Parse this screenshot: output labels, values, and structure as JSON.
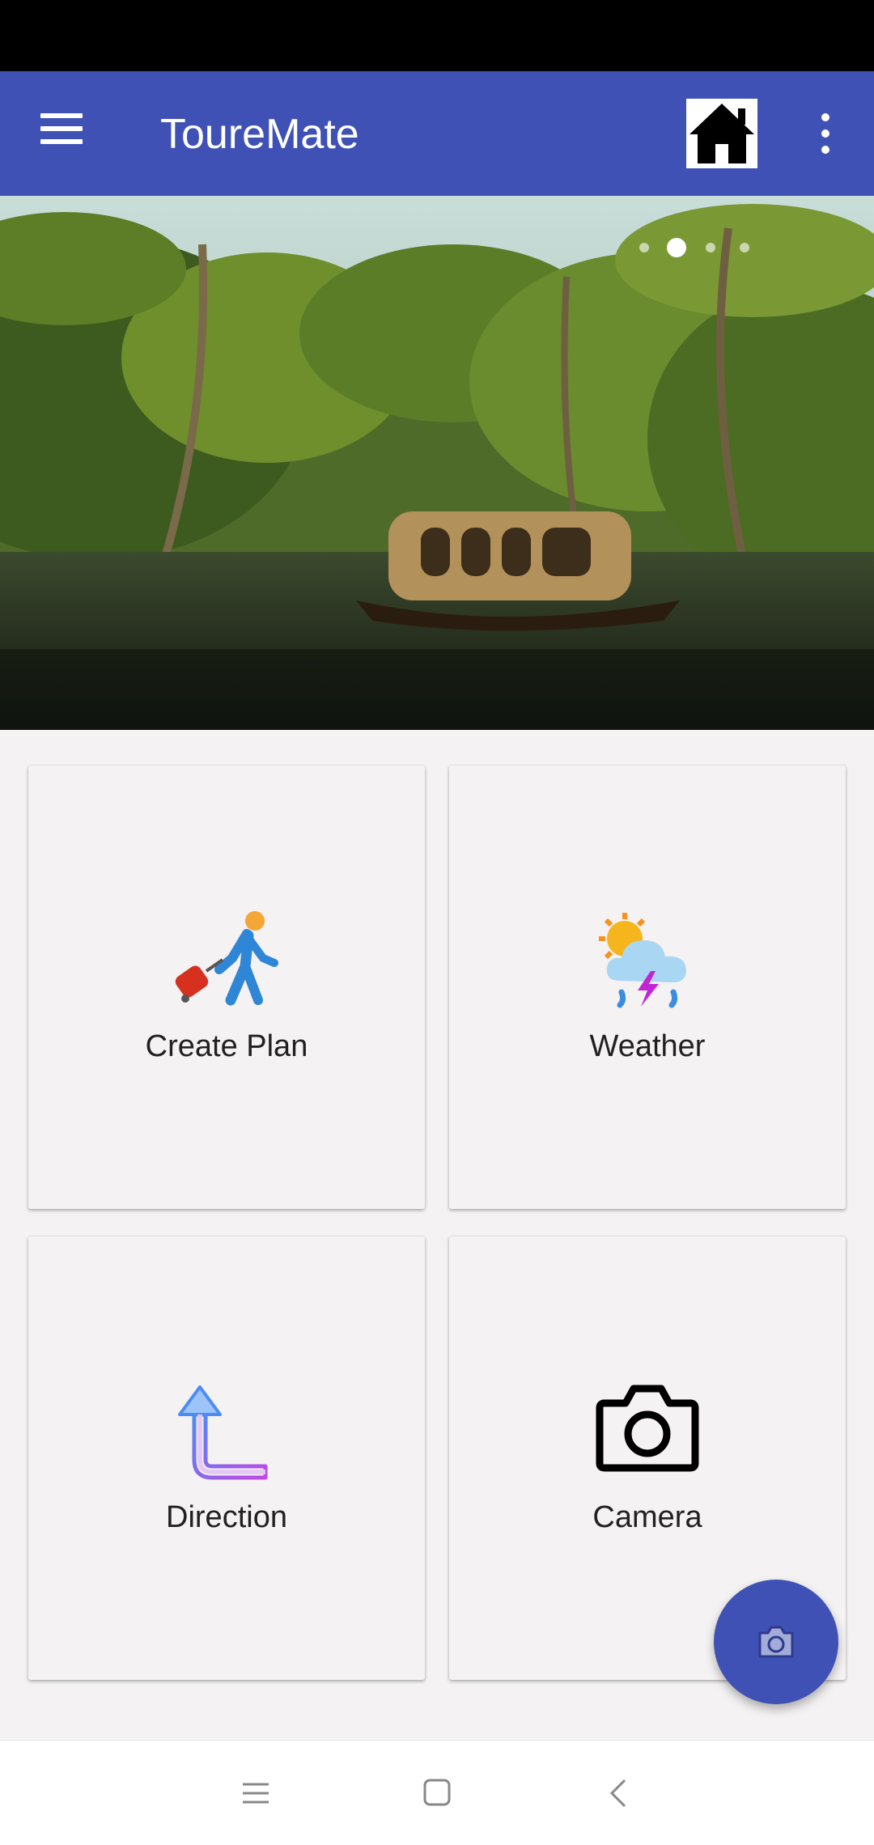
{
  "app_bar": {
    "title": "ToureMate",
    "menu_icon": "hamburger-menu-icon",
    "home_icon": "home-icon",
    "more_icon": "more-vert-icon",
    "color": "#3f51b5"
  },
  "banner": {
    "image": "backwater-houseboat-palms",
    "dot_count": 4,
    "active_dot": 1
  },
  "cards": [
    {
      "label": "Create Plan",
      "icon": "traveler-luggage-icon"
    },
    {
      "label": "Weather",
      "icon": "weather-storm-icon"
    },
    {
      "label": "Direction",
      "icon": "turn-arrow-icon"
    },
    {
      "label": "Camera",
      "icon": "camera-icon"
    }
  ],
  "fab": {
    "icon": "camera-icon"
  },
  "nav_bar": {
    "recents_icon": "recents-icon",
    "home_icon": "nav-home-icon",
    "back_icon": "back-icon"
  }
}
